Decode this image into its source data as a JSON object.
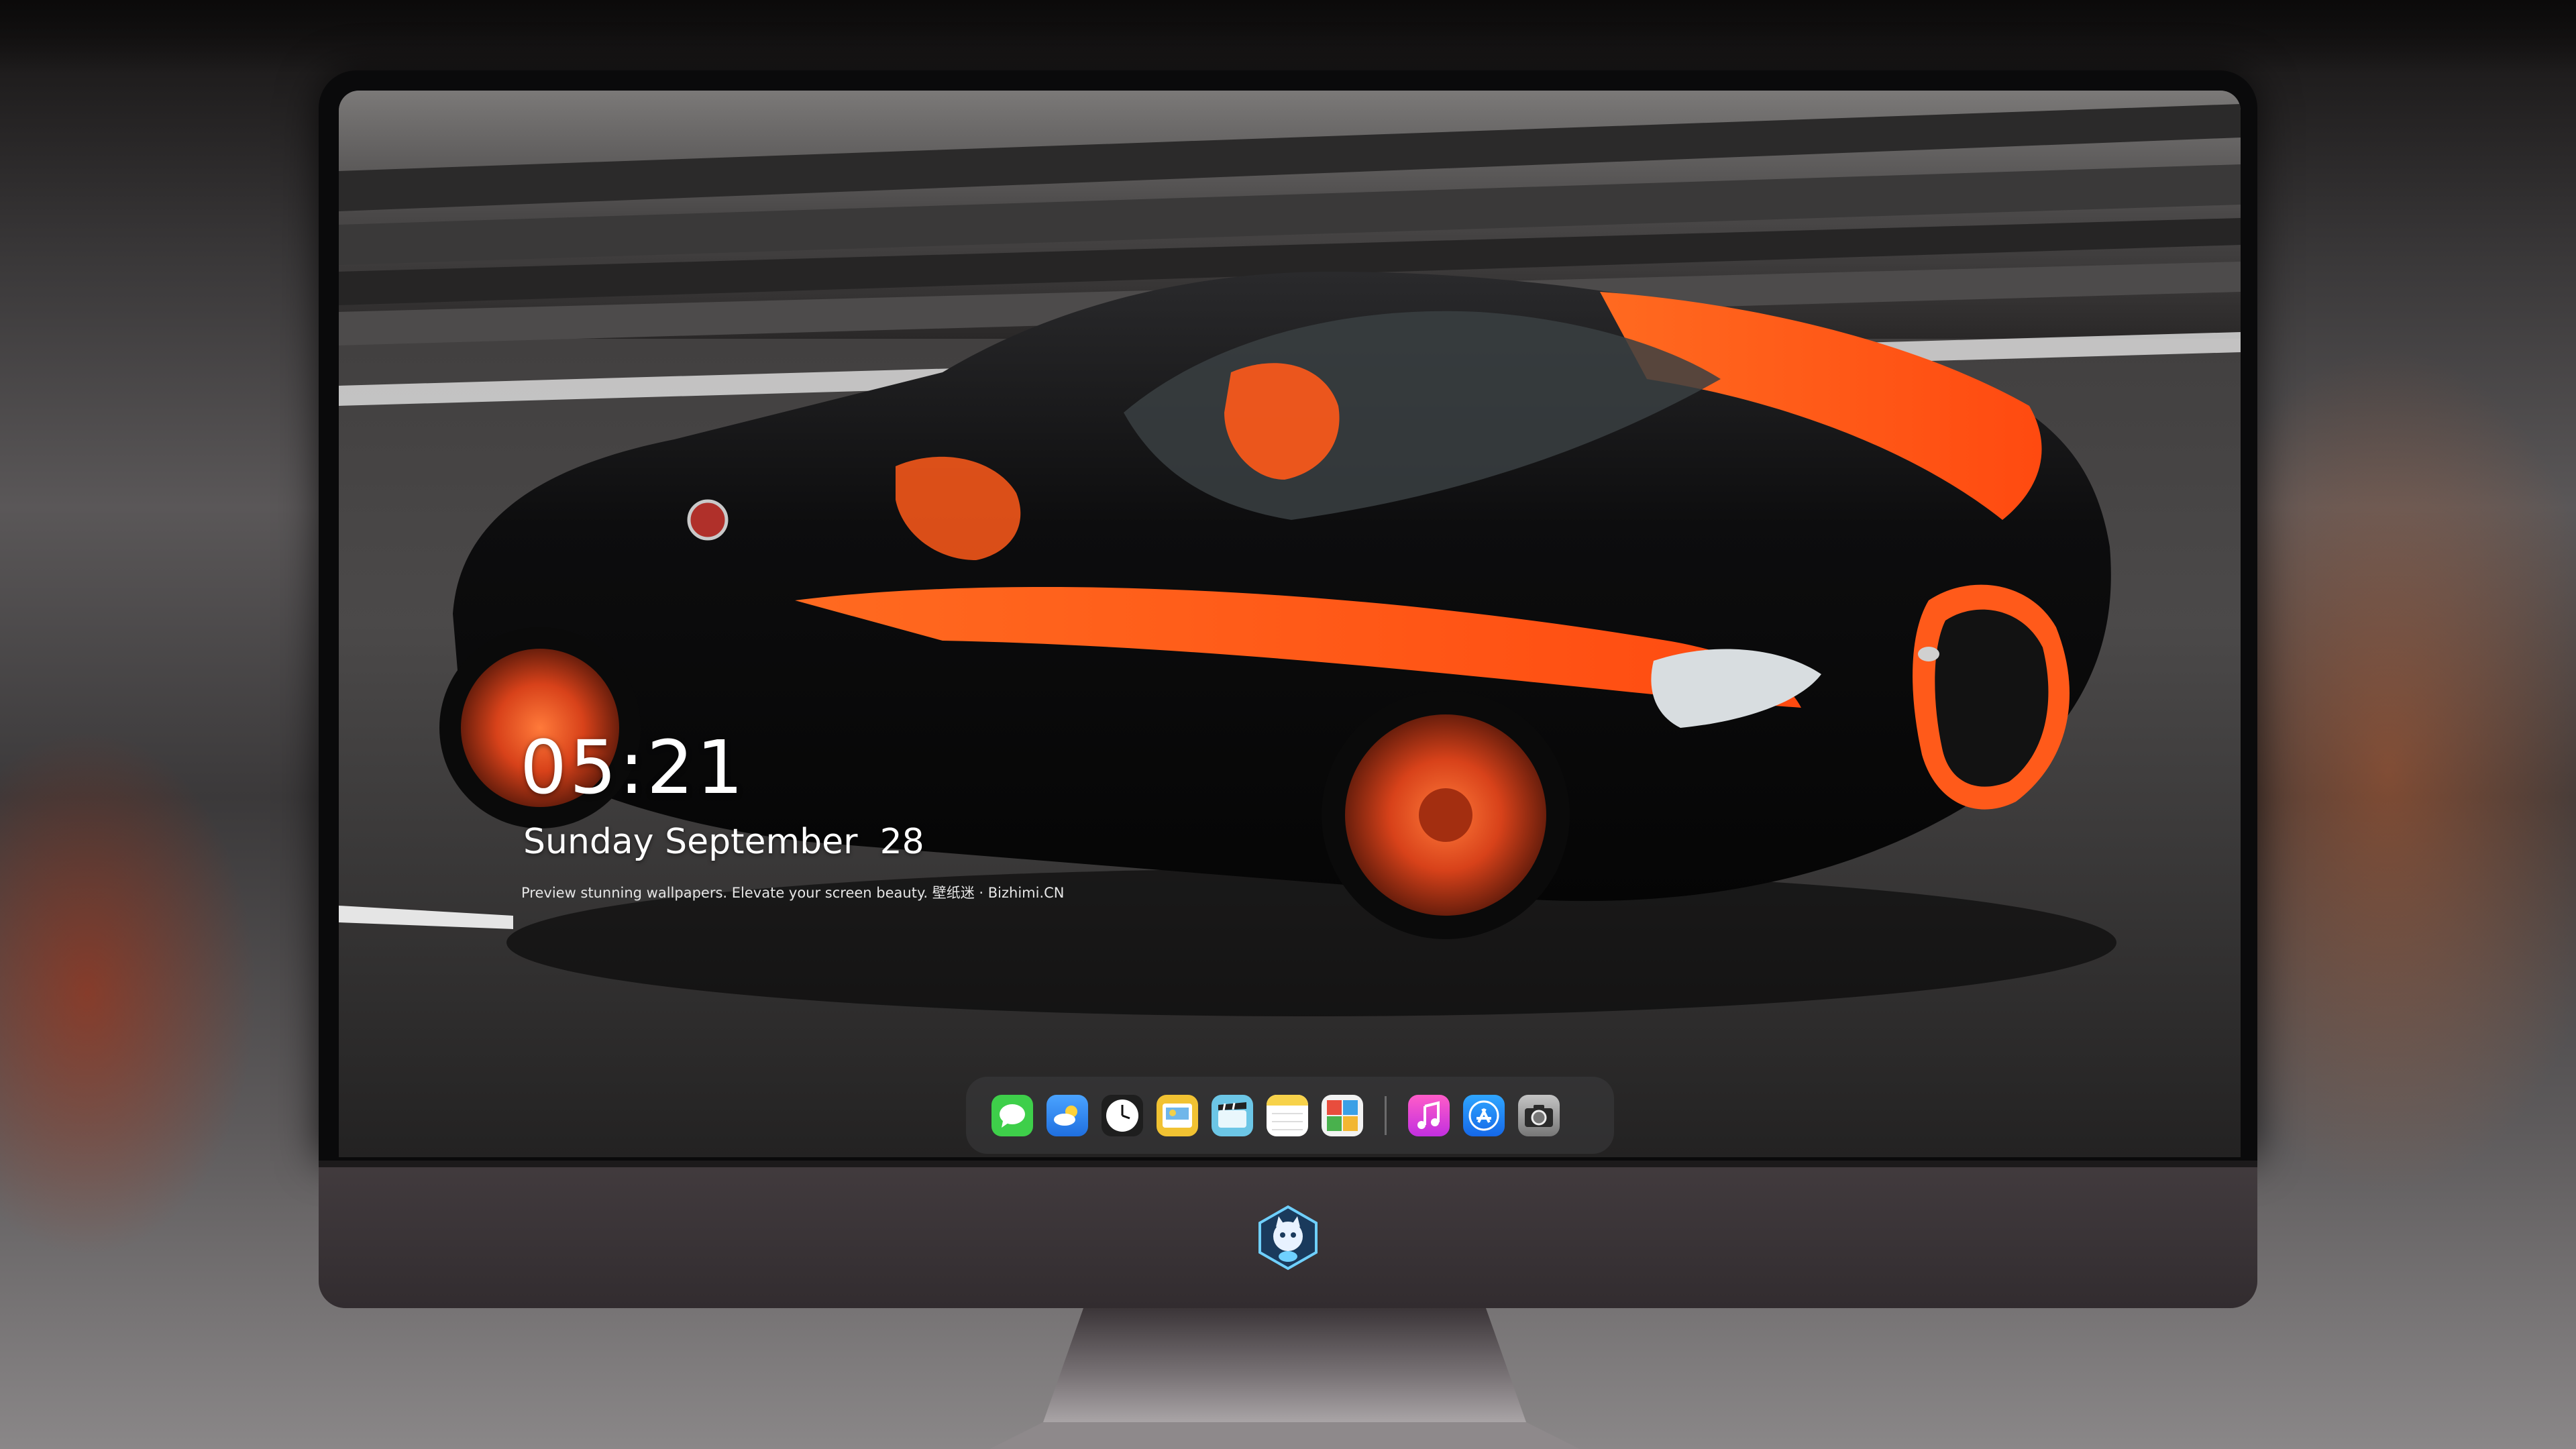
{
  "lock_screen": {
    "time": "05:21",
    "date": "Sunday September  28",
    "tagline": "Preview stunning wallpapers. Elevate your screen beauty. 壁纸迷 · Bizhimi.CN"
  },
  "dock": {
    "apps": [
      {
        "name": "messages-icon",
        "color": "#3ecf4a"
      },
      {
        "name": "weather-icon",
        "color": "#3a8ef0"
      },
      {
        "name": "clock-icon",
        "color": "#1e1e1e"
      },
      {
        "name": "preview-icon",
        "color": "#f1c232"
      },
      {
        "name": "clips-icon",
        "color": "#6cc6e6"
      },
      {
        "name": "notes-icon",
        "color": "#f7d24a"
      },
      {
        "name": "photo-booth-icon",
        "color": "#e84d3d"
      },
      {
        "name": "music-icon",
        "color": "#e63ad0"
      },
      {
        "name": "app-store-icon",
        "color": "#1c86f2"
      },
      {
        "name": "camera-icon",
        "color": "#8a8a8a"
      }
    ]
  },
  "colors": {
    "accent_orange": "#ff5a1a",
    "car_body": "#0c0c0c",
    "bezel": "#0a0a0b",
    "chin": "#3a3437"
  }
}
